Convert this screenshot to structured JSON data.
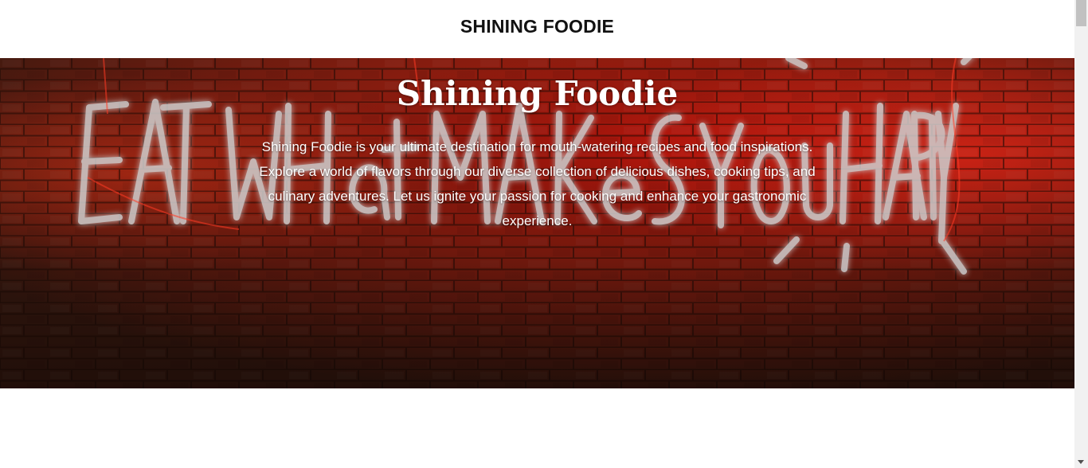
{
  "header": {
    "site_title": "SHINING FOODIE"
  },
  "hero": {
    "background_sign_text": "EAT WHat MAKeS YOU HAPPY",
    "heading": "Shining Foodie",
    "description": "Shining Foodie is your ultimate destination for mouth-watering recipes and food inspirations. Explore a world of flavors through our diverse collection of delicious dishes, cooking tips, and culinary adventures. Let us ignite your passion for cooking and enhance your gastronomic experience."
  },
  "colors": {
    "header_bg": "#ffffff",
    "title_text": "#111111",
    "hero_overlay": "#3a0f08",
    "neon_red": "#ff2a1a",
    "neon_tube": "#c9c9c9",
    "hero_text": "#ffffff"
  },
  "icons": {
    "scroll_down": "triangle-down"
  }
}
